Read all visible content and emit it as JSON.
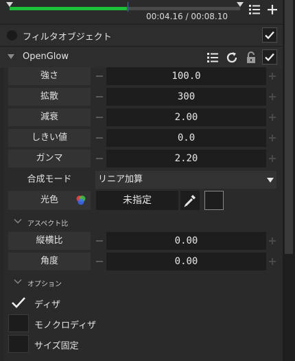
{
  "timeline": {
    "time_readout": "00:04.16 / 00:08.10",
    "progress": 0.51
  },
  "filter_object": {
    "label": "フィルタオブジェクト",
    "checked": true
  },
  "effect": {
    "name": "OpenGlow",
    "enabled": true,
    "params": [
      {
        "label": "強さ",
        "value": "100.0"
      },
      {
        "label": "拡散",
        "value": "300"
      },
      {
        "label": "減衰",
        "value": "2.00"
      },
      {
        "label": "しきい値",
        "value": "0.0"
      },
      {
        "label": "ガンマ",
        "value": "2.20"
      }
    ],
    "blend": {
      "label": "合成モード",
      "value": "リニア加算"
    },
    "color": {
      "label": "光色",
      "value": "未指定"
    },
    "aspect_section": {
      "title": "アスペクト比",
      "params": [
        {
          "label": "縦横比",
          "value": "0.00"
        },
        {
          "label": "角度",
          "value": "0.00"
        }
      ]
    },
    "options_section": {
      "title": "オプション",
      "items": [
        {
          "label": "ディザ",
          "checked": true
        },
        {
          "label": "モノクロディザ",
          "checked": false
        },
        {
          "label": "サイズ固定",
          "checked": false
        }
      ]
    }
  },
  "colors": {
    "accent_green": "#1fbf3a",
    "playhead_blue": "#3b6fd8",
    "background": "#262626"
  },
  "icons": [
    "list-icon",
    "plus-icon",
    "check-icon",
    "refresh-icon",
    "lock-icon",
    "chevron-down-icon",
    "eyedropper-icon",
    "color-wheel-icon"
  ]
}
